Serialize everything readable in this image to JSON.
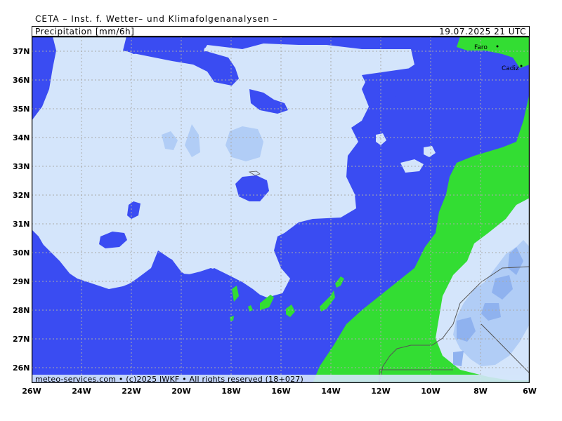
{
  "header": {
    "institute": "CETA – Inst. f. Wetter– und Klimafolgenanalysen –",
    "parameter": "Precipitation [mm/6h]",
    "valid_time": "19.07.2025 21 UTC"
  },
  "map": {
    "lat_labels": [
      "37N",
      "36N",
      "35N",
      "34N",
      "33N",
      "32N",
      "31N",
      "30N",
      "29N",
      "28N",
      "27N",
      "26N"
    ],
    "lon_labels": [
      "26W",
      "24W",
      "22W",
      "20W",
      "18W",
      "16W",
      "14W",
      "12W",
      "10W",
      "8W",
      "6W"
    ],
    "cities": [
      "Faro",
      "Cadiz"
    ],
    "colors": {
      "ocean": "#3a4cf2",
      "no_precip": "#d4e5fb",
      "light_precip": "#b1cdf6",
      "moderate_precip": "#8fb2ef",
      "land": "#33dd33",
      "grid": "#aaaaaa"
    }
  },
  "footer": {
    "credit": "meteo-services.com • (c)2025 IWKF • All rights reserved (18+027)"
  }
}
